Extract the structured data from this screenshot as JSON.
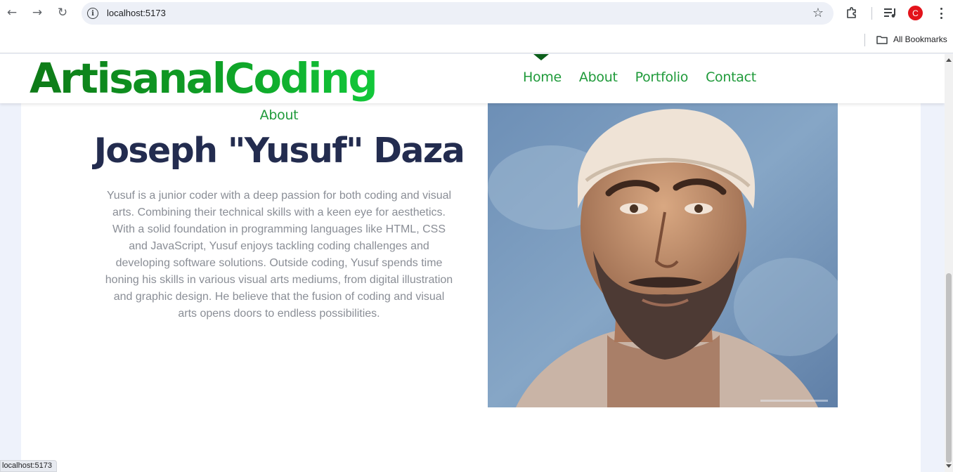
{
  "browser": {
    "url": "localhost:5173",
    "bookmarks_folder": "All Bookmarks",
    "profile_initial": "C",
    "status_url": "localhost:5173"
  },
  "site": {
    "logo": "ArtisanalCoding",
    "nav": [
      "Home",
      "About",
      "Portfolio",
      "Contact"
    ],
    "active_nav": "Home",
    "brand_colors": {
      "dark_green": "#0e7a17",
      "green": "#1f9a3a",
      "bright_green": "#12c83a",
      "navy": "#232c4f"
    }
  },
  "about": {
    "section_label": "About",
    "name": "Joseph \"Yusuf\" Daza",
    "bio": "Yusuf is a junior coder with a deep passion for both coding and visual arts. Combining their technical skills with a keen eye for aesthetics. With a solid foundation in programming languages like HTML, CSS and JavaScript, Yusuf enjoys tackling coding challenges and developing software solutions. Outside coding, Yusuf spends time honing his skills in various visual arts mediums, from digital illustration and graphic design. He believe that the fusion of coding and visual arts opens doors to endless possibilities."
  }
}
